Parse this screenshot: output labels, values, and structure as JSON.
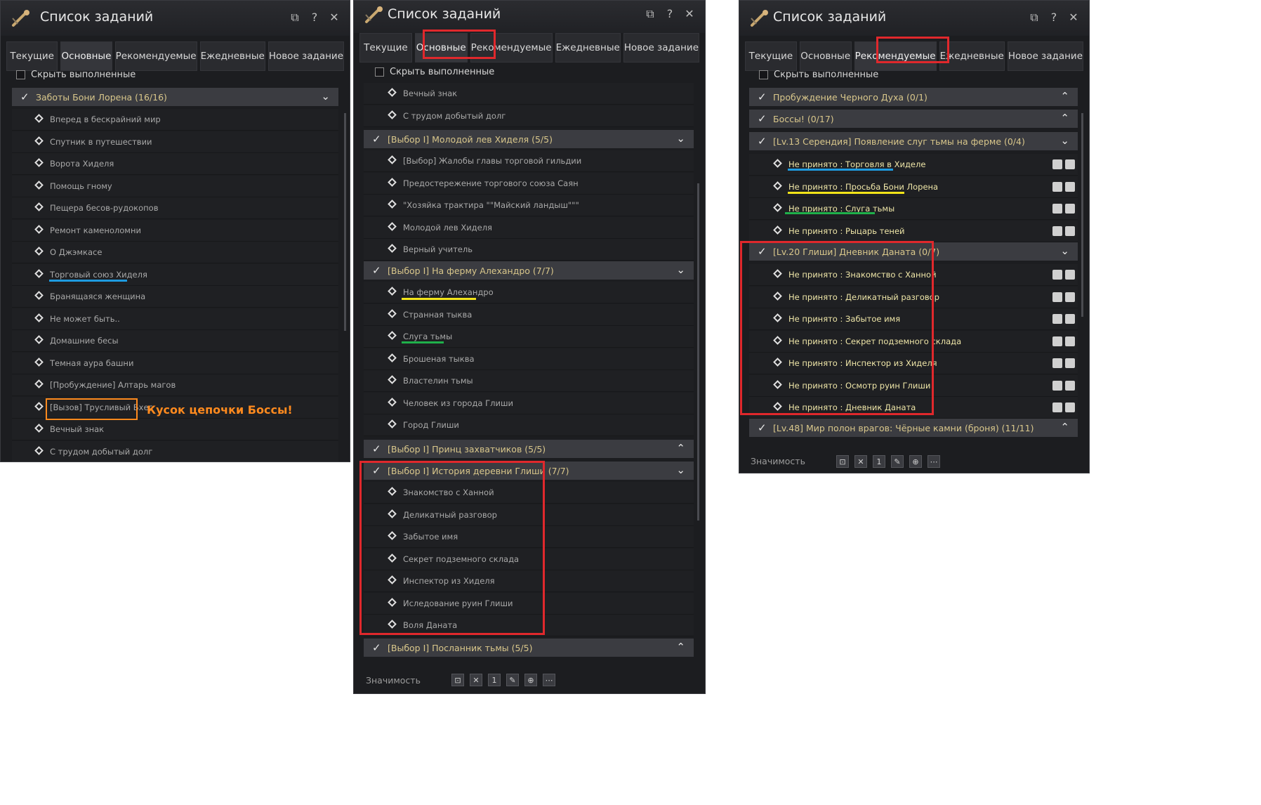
{
  "window": {
    "title": "Список заданий",
    "controls": [
      "⧉",
      "?",
      "✕"
    ],
    "hide_completed_label": "Скрыть выполненные",
    "footer_label": "Значимость"
  },
  "tabs": [
    "Текущие",
    "Основные",
    "Рекомендуемые",
    "Ежедневные",
    "Новое задание"
  ],
  "panel1": {
    "active_tab": 1,
    "group": "Заботы Бони Лорена (16/16)",
    "items": [
      "Вперед в бескрайний мир",
      "Спутник в путешествии",
      "Ворота Хиделя",
      "Помощь гному",
      "Пещера бесов-рудокопов",
      "Ремонт каменоломни",
      "О Джэмкасе",
      "Торговый союз Хиделя",
      "Бранящаяся женщина",
      "Не может быть..",
      "Домашние бесы",
      "Темная аура башни",
      "[Пробуждение] Алтарь магов",
      "[Вызов] Трусливый Бхег",
      "Вечный знак",
      "С трудом добытый долг"
    ],
    "annotation": "Кусок цепочки Боссы!"
  },
  "panel2": {
    "active_tab": 1,
    "top_items": [
      "Вечный знак",
      "С трудом добытый долг"
    ],
    "group1": "[Выбор I] Молодой лев Хиделя (5/5)",
    "group1_items": [
      "[Выбор] Жалобы главы торговой гильдии",
      "Предостережение торгового союза Саян",
      "\"Хозяйка трактира \"\"Майский ландыш\"\"\"",
      "Молодой лев Хиделя",
      "Верный учитель"
    ],
    "group2": "[Выбор I] На ферму Алехандро (7/7)",
    "group2_items": [
      "На ферму Алехандро",
      "Странная тыква",
      "Слуга тьмы",
      "Брошеная тыква",
      "Властелин тьмы",
      "Человек из города Глиши",
      "Город Глиши"
    ],
    "group3": "[Выбор I] Принц захватчиков (5/5)",
    "group4": "[Выбор I] История деревни Глиши (7/7)",
    "group4_items": [
      "Знакомство с Ханной",
      "Деликатный разговор",
      "Забытое имя",
      "Секрет подземного склада",
      "Инспектор из Хиделя",
      "Иследование руин Глиши",
      "Воля Даната"
    ],
    "group5": "[Выбор I] Посланник тьмы (5/5)"
  },
  "panel3": {
    "active_tab": 2,
    "group1": "Пробуждение Черного Духа (0/1)",
    "group2": "Боссы! (0/17)",
    "group3": "[Lv.13 Серендия] Появление слуг тьмы на ферме (0/4)",
    "group3_items": [
      "Не принято : Торговля в Хиделе",
      "Не принято : Просьба Бони Лорена",
      "Не принято : Слуга тьмы",
      "Не принято : Рыцарь теней"
    ],
    "group4": "[Lv.20 Глиши] Дневник Даната (0/7)",
    "group4_items": [
      "Не принято : Знакомство с Ханной",
      "Не принято : Деликатный разговор",
      "Не принято : Забытое имя",
      "Не принято : Секрет подземного склада",
      "Не принято : Инспектор из Хиделя",
      "Не принято : Осмотр руин Глиши",
      "Не принято : Дневник Даната"
    ],
    "group5": "[Lv.48] Мир полон врагов: Чёрные камни (броня) (11/11)"
  },
  "colors": {
    "highlight_red": "#e0282c",
    "underline_blue": "#1e9be0",
    "underline_yellow": "#f2e419",
    "underline_green": "#1fb04a",
    "annotation_orange": "#ff8a1e"
  },
  "icons": {
    "logo": "spyglass-icon",
    "quest_item": "diamond-marker-icon",
    "group_check": "checkmark-icon",
    "group_toggle": "chevron-icon"
  }
}
